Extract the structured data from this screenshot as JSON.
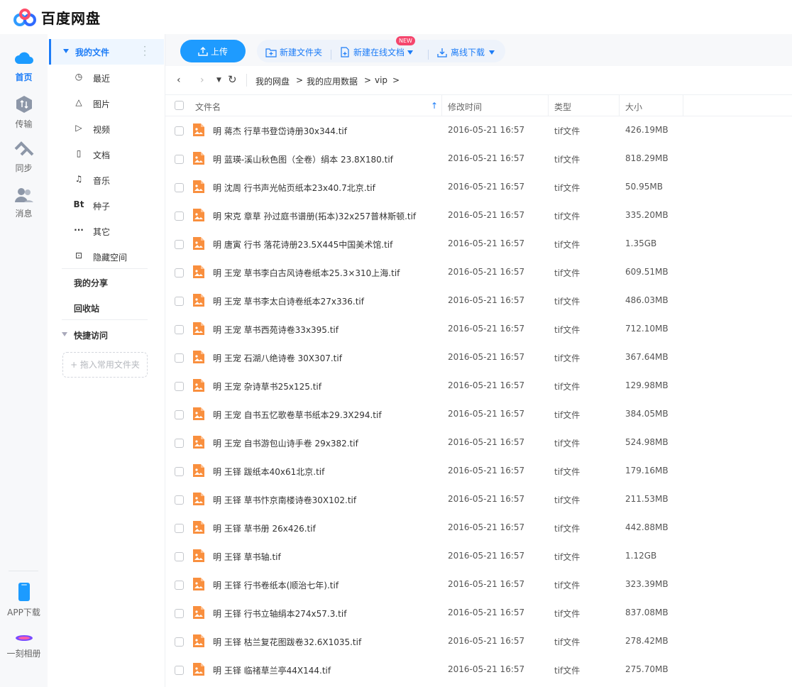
{
  "app": {
    "title": "百度网盘"
  },
  "rail": {
    "items": [
      {
        "label": "首页",
        "icon": "cloud-icon",
        "active": true
      },
      {
        "label": "传输",
        "icon": "transfer-icon"
      },
      {
        "label": "同步",
        "icon": "sync-icon"
      },
      {
        "label": "消息",
        "icon": "message-icon"
      }
    ],
    "bottom": [
      {
        "label": "APP下载",
        "icon": "phone-icon"
      },
      {
        "label": "一刻相册",
        "icon": "album-icon"
      }
    ]
  },
  "sidebar": {
    "my_files": "我的文件",
    "categories": [
      {
        "label": "最近",
        "icon": "clock-icon",
        "glyph": "◷"
      },
      {
        "label": "图片",
        "icon": "image-icon",
        "glyph": "△"
      },
      {
        "label": "视频",
        "icon": "video-icon",
        "glyph": "▷"
      },
      {
        "label": "文档",
        "icon": "document-icon",
        "glyph": "▯"
      },
      {
        "label": "音乐",
        "icon": "headphone-icon",
        "glyph": "♫"
      },
      {
        "label": "种子",
        "icon": "bt-icon",
        "glyph": "Bt"
      },
      {
        "label": "其它",
        "icon": "more-icon",
        "glyph": "···"
      },
      {
        "label": "隐藏空间",
        "icon": "lock-icon",
        "glyph": "⊡"
      }
    ],
    "my_share": "我的分享",
    "recycle_bin": "回收站",
    "quick_access": "快捷访问",
    "drop_hint": "+ 拖入常用文件夹"
  },
  "toolbar": {
    "upload": "上传",
    "new_folder": "新建文件夹",
    "new_online_doc": "新建在线文档",
    "new_badge": "NEW",
    "offline_download": "离线下载"
  },
  "breadcrumb": [
    "我的网盘",
    "我的应用数据",
    "vip"
  ],
  "table": {
    "headers": {
      "name": "文件名",
      "modified": "修改时间",
      "type": "类型",
      "size": "大小"
    },
    "rows": [
      {
        "name": "明 蒋杰 行草书登岱诗册30x344.tif",
        "modified": "2016-05-21 16:57",
        "type": "tif文件",
        "size": "426.19MB"
      },
      {
        "name": "明 蓝瑛-溪山秋色图（全卷）绢本 23.8X180.tif",
        "modified": "2016-05-21 16:57",
        "type": "tif文件",
        "size": "818.29MB"
      },
      {
        "name": "明 沈周 行书声光帖页纸本23x40.7北京.tif",
        "modified": "2016-05-21 16:57",
        "type": "tif文件",
        "size": "50.95MB"
      },
      {
        "name": "明 宋克 章草 孙过庭书谱册(拓本)32x257普林斯顿.tif",
        "modified": "2016-05-21 16:57",
        "type": "tif文件",
        "size": "335.20MB"
      },
      {
        "name": "明 唐寅 行书 落花诗册23.5X445中国美术馆.tif",
        "modified": "2016-05-21 16:57",
        "type": "tif文件",
        "size": "1.35GB"
      },
      {
        "name": "明 王宠 草书李白古风诗卷纸本25.3×310上海.tif",
        "modified": "2016-05-21 16:57",
        "type": "tif文件",
        "size": "609.51MB"
      },
      {
        "name": "明 王宠 草书李太白诗卷纸本27x336.tif",
        "modified": "2016-05-21 16:57",
        "type": "tif文件",
        "size": "486.03MB"
      },
      {
        "name": "明 王宠 草书西苑诗卷33x395.tif",
        "modified": "2016-05-21 16:57",
        "type": "tif文件",
        "size": "712.10MB"
      },
      {
        "name": "明 王宠 石湖八绝诗卷 30X307.tif",
        "modified": "2016-05-21 16:57",
        "type": "tif文件",
        "size": "367.64MB"
      },
      {
        "name": "明 王宠 杂诗草书25x125.tif",
        "modified": "2016-05-21 16:57",
        "type": "tif文件",
        "size": "129.98MB"
      },
      {
        "name": "明 王宠 自书五忆歌卷草书纸本29.3X294.tif",
        "modified": "2016-05-21 16:57",
        "type": "tif文件",
        "size": "384.05MB"
      },
      {
        "name": "明 王宠 自书游包山诗手卷 29x382.tif",
        "modified": "2016-05-21 16:57",
        "type": "tif文件",
        "size": "524.98MB"
      },
      {
        "name": "明 王铎 跋纸本40x61北京.tif",
        "modified": "2016-05-21 16:57",
        "type": "tif文件",
        "size": "179.16MB"
      },
      {
        "name": "明 王铎 草书忭京南楼诗卷30X102.tif",
        "modified": "2016-05-21 16:57",
        "type": "tif文件",
        "size": "211.53MB"
      },
      {
        "name": "明 王铎 草书册 26x426.tif",
        "modified": "2016-05-21 16:57",
        "type": "tif文件",
        "size": "442.88MB"
      },
      {
        "name": "明 王铎 草书轴.tif",
        "modified": "2016-05-21 16:57",
        "type": "tif文件",
        "size": "1.12GB"
      },
      {
        "name": "明 王铎 行书卷纸本(顺治七年).tif",
        "modified": "2016-05-21 16:57",
        "type": "tif文件",
        "size": "323.39MB"
      },
      {
        "name": "明 王铎 行书立轴绢本274x57.3.tif",
        "modified": "2016-05-21 16:57",
        "type": "tif文件",
        "size": "837.08MB"
      },
      {
        "name": "明 王铎 枯兰复花图跋卷32.6X1035.tif",
        "modified": "2016-05-21 16:57",
        "type": "tif文件",
        "size": "278.42MB"
      },
      {
        "name": "明 王铎 临禇草兰亭44X144.tif",
        "modified": "2016-05-21 16:57",
        "type": "tif文件",
        "size": "275.70MB"
      }
    ]
  },
  "colors": {
    "accent": "#1c7cf7",
    "upload": "#1e9bff",
    "file_icon": "#f98f3e",
    "badge": "#f5466d"
  }
}
